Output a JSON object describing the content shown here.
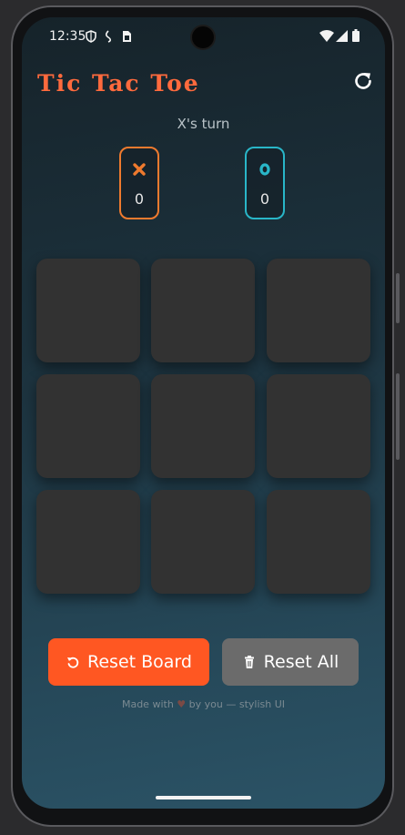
{
  "status_bar": {
    "time": "12:35",
    "icons": [
      "shield-icon",
      "fingerprint-icon",
      "sim-card-icon",
      "wifi-icon",
      "signal-icon",
      "battery-icon"
    ]
  },
  "app": {
    "title": "Tic Tac Toe",
    "refresh_icon": "refresh-icon",
    "turn_text": "X's turn"
  },
  "scores": {
    "x": {
      "symbol": "x-icon",
      "value": "0",
      "color": "#ef7a2e"
    },
    "o": {
      "symbol": "o-icon",
      "value": "0",
      "color": "#29b6c8"
    }
  },
  "board": {
    "cells": [
      "",
      "",
      "",
      "",
      "",
      "",
      "",
      "",
      ""
    ]
  },
  "buttons": {
    "reset_board": {
      "label": "Reset Board",
      "icon": "undo-icon",
      "color": "#ff5722"
    },
    "reset_all": {
      "label": "Reset All",
      "icon": "trash-icon",
      "color": "#6b6b6b"
    }
  },
  "footer": {
    "text_before": "Made with",
    "heart": "♥",
    "text_after": "by you — stylish UI"
  }
}
